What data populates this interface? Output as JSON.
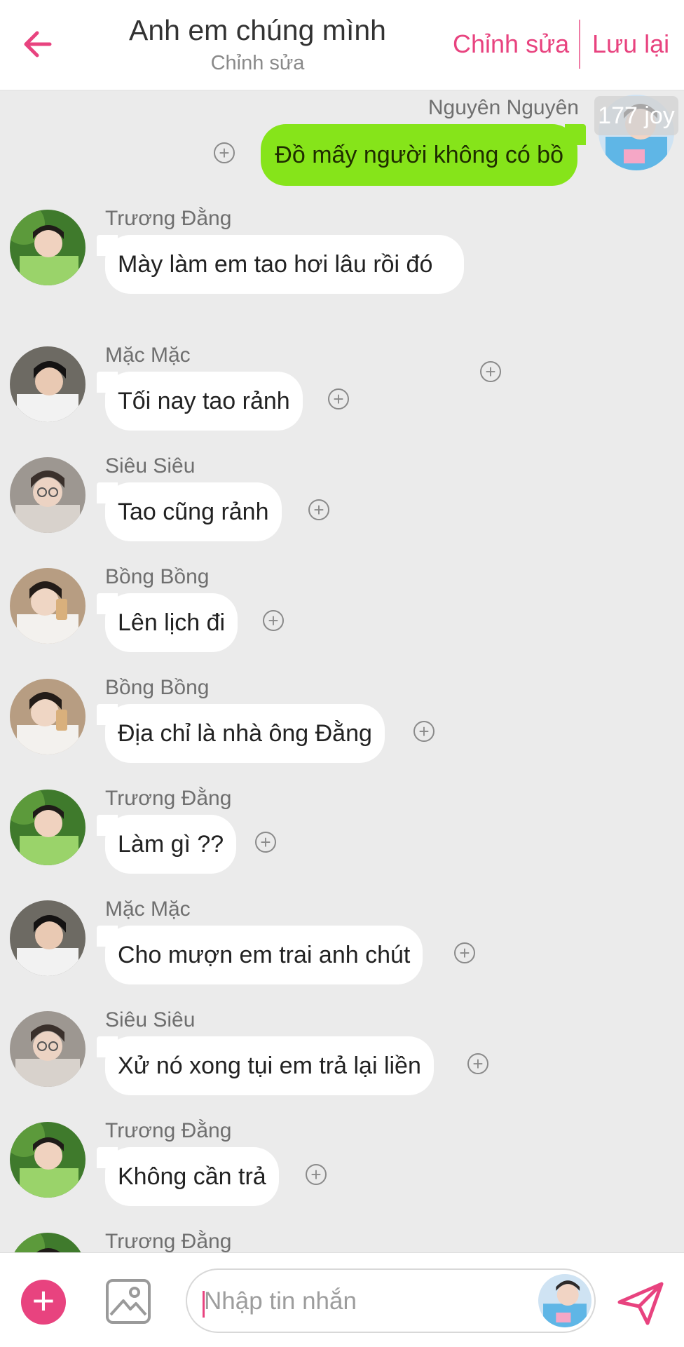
{
  "header": {
    "title": "Anh em chúng mình",
    "subtitle": "Chỉnh sửa",
    "edit_label": "Chỉnh sửa",
    "save_label": "Lưu lại"
  },
  "own_message": {
    "sender": "Nguyên Nguyên",
    "text": "Đồ mấy người không có bồ",
    "badge": "177 joy"
  },
  "messages": [
    {
      "sender": "Trương Đằng",
      "text": "Mày làm em tao hơi lâu rồi đó"
    },
    {
      "sender": "Mặc Mặc",
      "text": "Tối nay tao rảnh"
    },
    {
      "sender": "Siêu Siêu",
      "text": "Tao cũng rảnh"
    },
    {
      "sender": "Bồng Bồng",
      "text": "Lên lịch đi"
    },
    {
      "sender": "Bồng Bồng",
      "text": "Địa chỉ là nhà ông Đằng"
    },
    {
      "sender": "Trương Đằng",
      "text": "Làm gì ??"
    },
    {
      "sender": "Mặc Mặc",
      "text": "Cho mượn em trai anh chút"
    },
    {
      "sender": "Siêu Siêu",
      "text": "Xử nó xong tụi em trả lại liền"
    },
    {
      "sender": "Trương Đằng",
      "text": "Không cần trả"
    },
    {
      "sender": "Trương Đằng",
      "text": ""
    }
  ],
  "composer": {
    "placeholder": "Nhập tin nhắn"
  },
  "icons": {
    "back": "arrow-left-icon",
    "add": "plus-icon",
    "image": "image-icon",
    "send": "send-icon",
    "message_action": "plus-circle-icon"
  },
  "colors": {
    "accent": "#e8437f",
    "own_bubble": "#86e41a",
    "background": "#ebebeb"
  }
}
